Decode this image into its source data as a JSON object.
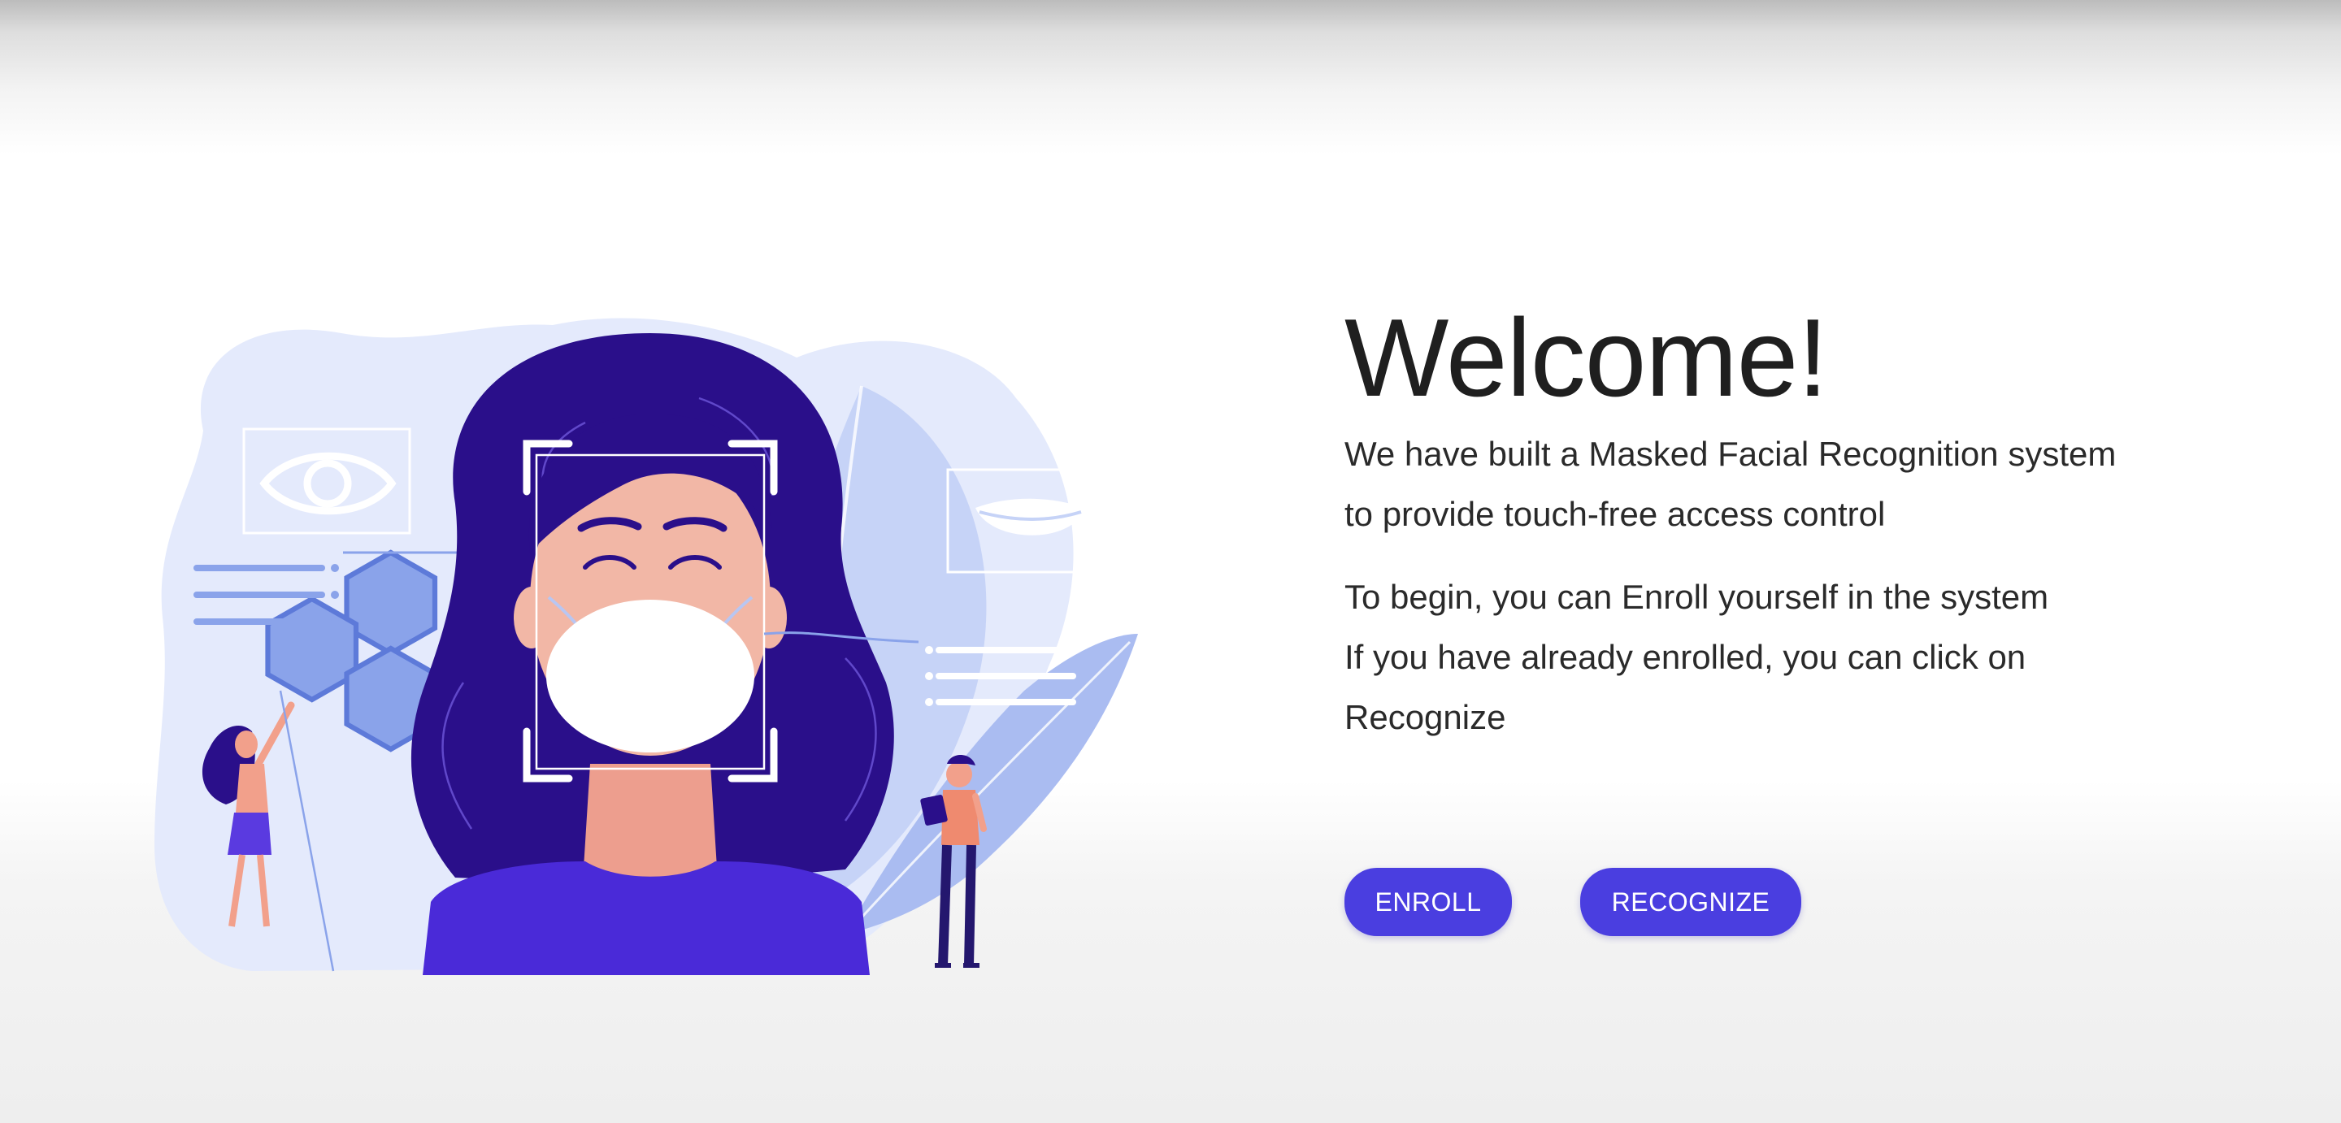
{
  "welcome": {
    "title": "Welcome!",
    "intro_line1": "We have built a Masked Facial Recognition system",
    "intro_line2": "to provide touch-free access control",
    "instr_line1": "To begin, you can Enroll yourself in the system",
    "instr_line2": "If you have already enrolled, you can click on",
    "instr_line3": "Recognize"
  },
  "actions": {
    "enroll_label": "ENROLL",
    "recognize_label": "RECOGNIZE"
  },
  "colors": {
    "accent": "#4a3ee0",
    "hair": "#2a0f8a",
    "skin": "#f2b7a6",
    "blob": "#e4eafc",
    "mid_blue": "#aabcf1"
  },
  "illustration": {
    "icons": [
      "eye-icon",
      "mouth-icon",
      "face-frame-icon",
      "hexagon-icon"
    ]
  }
}
